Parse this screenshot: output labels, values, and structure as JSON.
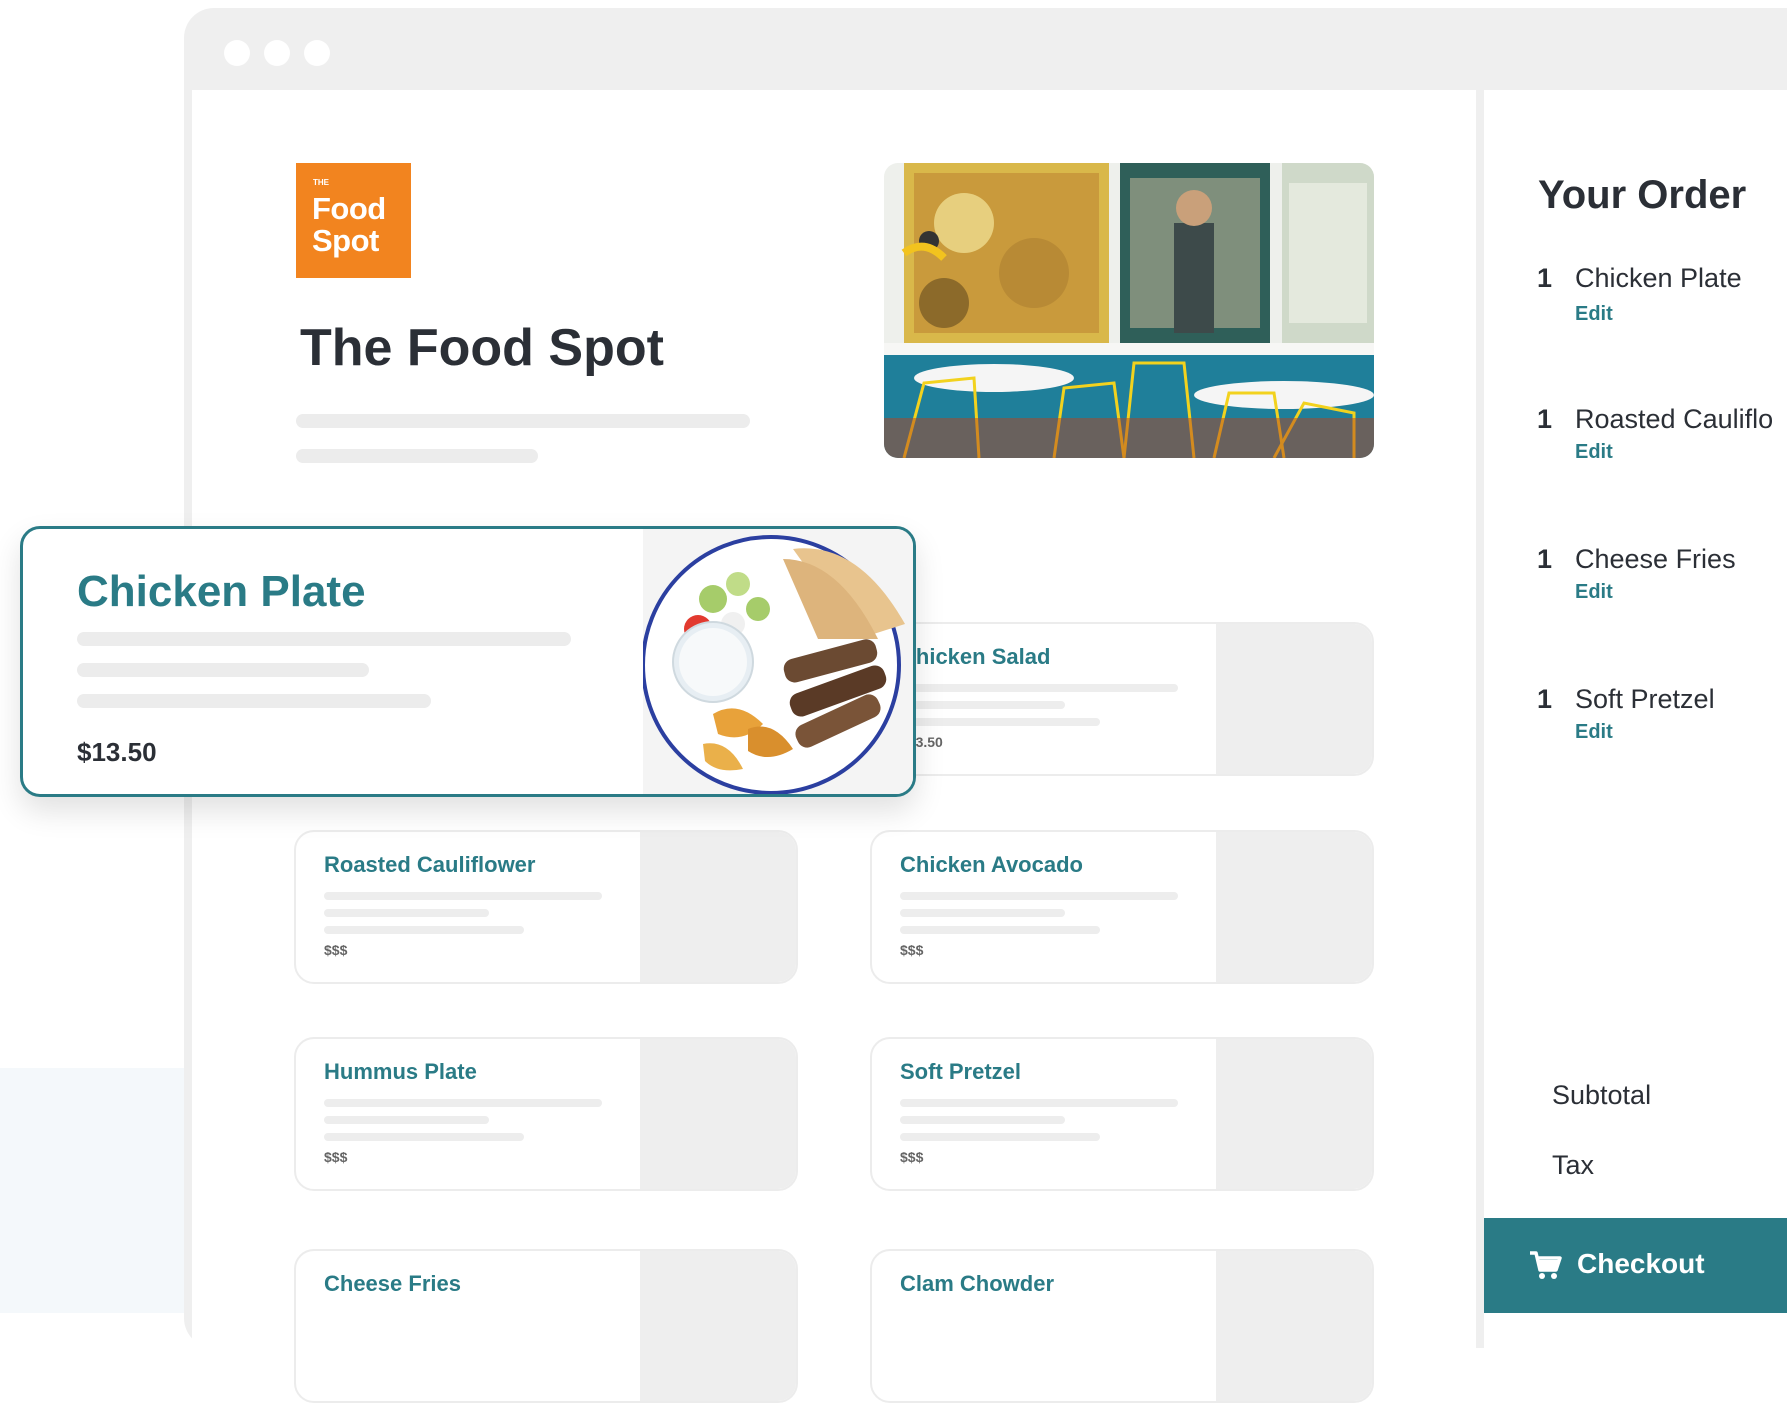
{
  "restaurant": {
    "logo_the": "THE",
    "logo_line1": "Food",
    "logo_line2": "Spot",
    "name": "The Food Spot"
  },
  "featured_item": {
    "name": "Chicken Plate",
    "price": "$13.50"
  },
  "menu_items": [
    {
      "name": "Chicken Salad",
      "price": "$13.50"
    },
    {
      "name": "Roasted Cauliflower",
      "price": "$$$"
    },
    {
      "name": "Chicken Avocado",
      "price": "$$$"
    },
    {
      "name": "Hummus Plate",
      "price": "$$$"
    },
    {
      "name": "Soft Pretzel",
      "price": "$$$"
    },
    {
      "name": "Cheese Fries",
      "price": ""
    },
    {
      "name": "Clam Chowder",
      "price": ""
    }
  ],
  "order": {
    "title": "Your Order",
    "items": [
      {
        "qty": "1",
        "name": "Chicken Plate",
        "edit": "Edit"
      },
      {
        "qty": "1",
        "name": "Roasted Cauliflo",
        "edit": "Edit"
      },
      {
        "qty": "1",
        "name": "Cheese Fries",
        "edit": "Edit"
      },
      {
        "qty": "1",
        "name": "Soft Pretzel",
        "edit": "Edit"
      }
    ],
    "subtotal_label": "Subtotal",
    "tax_label": "Tax",
    "checkout_label": "Checkout"
  },
  "colors": {
    "brand_orange": "#f2841f",
    "accent_teal": "#2a7b86"
  }
}
